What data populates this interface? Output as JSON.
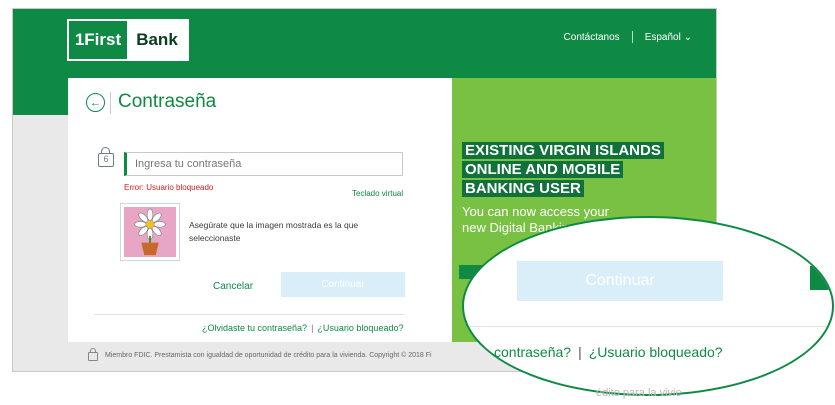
{
  "header": {
    "logo_left": "1First",
    "logo_right": "Bank",
    "contact": "Contáctanos",
    "language": "Español"
  },
  "login": {
    "title": "Contraseña",
    "password_placeholder": "Ingresa tu contraseña",
    "error": "Error: Usuario bloqueado",
    "virtual_keyboard": "Teclado virtual",
    "security_message": "Asegúrate que la imagen mostrada es la que seleccionaste",
    "cancel": "Cancelar",
    "continue": "Continuar",
    "forgot_password": "¿Olvidaste tu contraseña?",
    "separator": "|",
    "blocked_user": "¿Usuario bloqueado?"
  },
  "promo": {
    "headline_1": "EXISTING VIRGIN ISLANDS",
    "headline_2": "ONLINE AND MOBILE",
    "headline_3": "BANKING USER",
    "sub_1": "You can now access your",
    "sub_2": "new Digital Banking"
  },
  "footer": {
    "text": "Miembro FDIC. Prestamista con igualdad de oportunidad de crédito para la vivienda. Copyright © 2018 Fi"
  },
  "zoom": {
    "continue": "Continuar",
    "link_left": "contraseña?",
    "separator": "|",
    "link_right": "¿Usuario bloqueado?",
    "bleed_text": "édito para la vivie"
  },
  "colors": {
    "brand_green": "#0f8a44",
    "promo_green": "#79c143",
    "error_red": "#cc1f1f",
    "button_disabled": "#d9eef8"
  }
}
